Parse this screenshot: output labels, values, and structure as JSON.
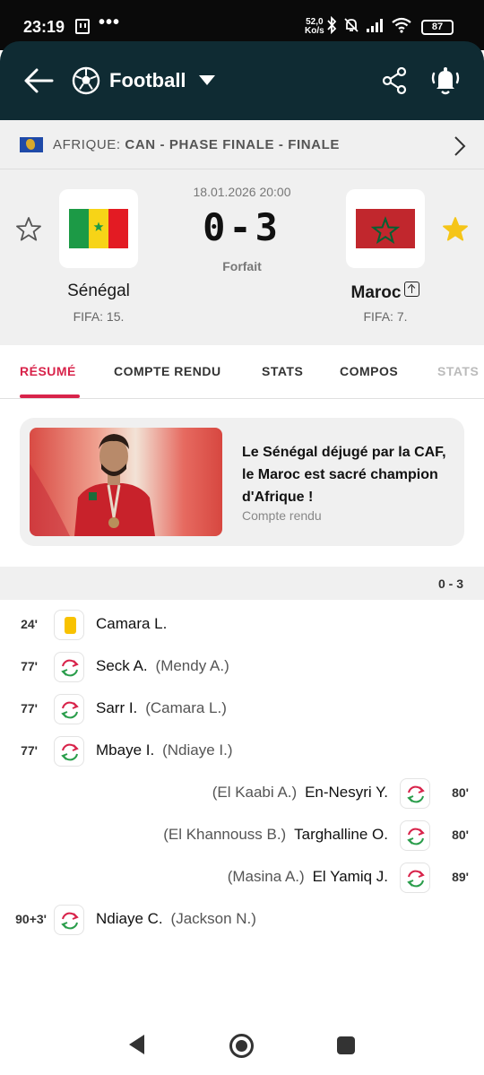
{
  "status_bar": {
    "time": "23:19",
    "more": "•••",
    "net_speed_value": "52,0",
    "net_speed_unit": "Ko/s",
    "battery": "87"
  },
  "header": {
    "title": "Football",
    "icons": [
      "back-arrow-icon",
      "football-icon",
      "chevron-down-icon",
      "share-icon",
      "bell-icon"
    ]
  },
  "competition": {
    "region": "AFRIQUE:",
    "name": "CAN - PHASE FINALE - FINALE"
  },
  "match": {
    "datetime": "18.01.2026 20:00",
    "score": "0-3",
    "status": "Forfait",
    "home": {
      "name": "Sénégal",
      "rank": "FIFA: 15.",
      "favorite": false
    },
    "away": {
      "name": "Maroc",
      "rank": "FIFA: 7.",
      "favorite": true
    }
  },
  "tabs": [
    {
      "label": "RÉSUMÉ",
      "active": true
    },
    {
      "label": "COMPTE RENDU",
      "active": false
    },
    {
      "label": "STATS",
      "active": false
    },
    {
      "label": "COMPOS",
      "active": false
    },
    {
      "label": "STATS",
      "active": false
    }
  ],
  "news": {
    "title": "Le Sénégal déjugé par la CAF, le Maroc est sacré champion d'Afrique !",
    "subtitle": "Compte rendu"
  },
  "events_score": "0 - 3",
  "events": [
    {
      "minute": "24'",
      "side": "home",
      "type": "yellow-card",
      "player": "Camara L.",
      "sub": ""
    },
    {
      "minute": "77'",
      "side": "home",
      "type": "substitution",
      "player": "Seck A.",
      "sub": "(Mendy A.)"
    },
    {
      "minute": "77'",
      "side": "home",
      "type": "substitution",
      "player": "Sarr I.",
      "sub": "(Camara L.)"
    },
    {
      "minute": "77'",
      "side": "home",
      "type": "substitution",
      "player": "Mbaye I.",
      "sub": "(Ndiaye I.)"
    },
    {
      "minute": "80'",
      "side": "away",
      "type": "substitution",
      "player": "En-Nesyri Y.",
      "sub": "(El Kaabi A.)"
    },
    {
      "minute": "80'",
      "side": "away",
      "type": "substitution",
      "player": "Targhalline O.",
      "sub": "(El Khannouss B.)"
    },
    {
      "minute": "89'",
      "side": "away",
      "type": "substitution",
      "player": "El Yamiq J.",
      "sub": "(Masina A.)"
    },
    {
      "minute": "90+3'",
      "side": "home",
      "type": "substitution",
      "player": "Ndiaye C.",
      "sub": "(Jackson N.)"
    }
  ],
  "colors": {
    "accent": "#d8234a",
    "header_bg": "#0f2b33",
    "star_active": "#f5c518"
  }
}
